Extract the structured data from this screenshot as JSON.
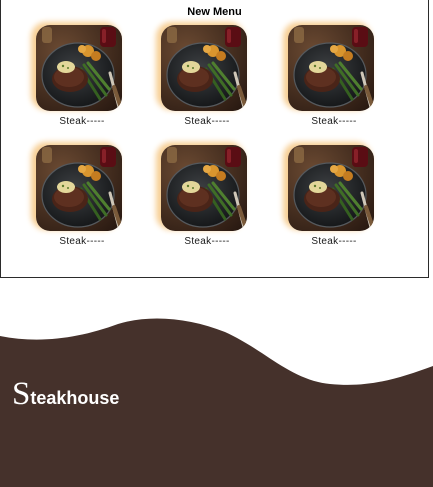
{
  "menu": {
    "title": "New Menu",
    "items": [
      {
        "label": "Steak-----",
        "image": "steak-plate-image"
      },
      {
        "label": "Steak-----",
        "image": "steak-plate-image"
      },
      {
        "label": "Steak-----",
        "image": "steak-plate-image"
      },
      {
        "label": "Steak-----",
        "image": "steak-plate-image"
      },
      {
        "label": "Steak-----",
        "image": "steak-plate-image"
      },
      {
        "label": "Steak-----",
        "image": "steak-plate-image"
      }
    ]
  },
  "footer": {
    "brand_initial": "S",
    "brand_rest": "teakhouse",
    "background_color": "#45312b"
  },
  "colors": {
    "card_glow": "#f7cf95",
    "footer_brown": "#45312b"
  }
}
